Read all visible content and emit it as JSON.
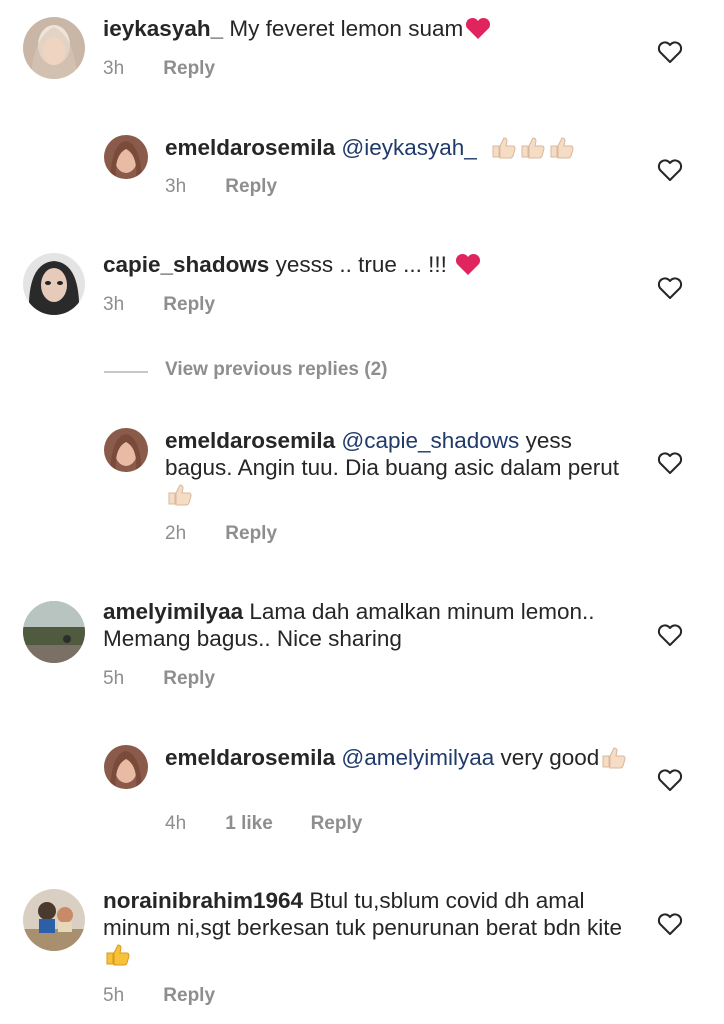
{
  "comments": [
    {
      "id": "c1",
      "username": "ieykasyah_",
      "text": "My feveret lemon suam",
      "emoji_after": "heart",
      "time": "3h",
      "reply": "Reply"
    },
    {
      "id": "r1",
      "username": "emeldarosemila",
      "mention": "@ieykasyah_",
      "text": "",
      "emoji_after": "thumbs3",
      "time": "3h",
      "reply": "Reply"
    },
    {
      "id": "c2",
      "username": "capie_shadows",
      "text": "yesss .. true ... !!!",
      "emoji_after": "heart",
      "time": "3h",
      "reply": "Reply"
    },
    {
      "id": "r2",
      "username": "emeldarosemila",
      "mention": "@capie_shadows",
      "text": "yess bagus. Angin tuu. Dia buang asic dalam perut",
      "emoji_after": "thumb",
      "time": "2h",
      "reply": "Reply"
    },
    {
      "id": "c3",
      "username": "amelyimilyaa",
      "text": "Lama dah amalkan minum lemon.. Memang bagus.. Nice sharing",
      "time": "5h",
      "reply": "Reply"
    },
    {
      "id": "r3",
      "username": "emeldarosemila",
      "mention": "@amelyimilyaa",
      "text": "very good",
      "emoji_after": "thumb",
      "time": "4h",
      "likes": "1 like",
      "reply": "Reply"
    },
    {
      "id": "c4",
      "username": "norainibrahim1964",
      "text": "Btul tu,sblum covid dh amal minum ni,sgt berkesan tuk penurunan berat bdn kite",
      "emoji_after": "thumb-yellow",
      "time": "5h",
      "reply": "Reply"
    }
  ],
  "view_previous": "View previous replies (2)",
  "icons": {
    "like": "heart-outline-icon"
  },
  "colors": {
    "text": "#262626",
    "meta": "#8e8e8e",
    "mention": "#1f3a6b",
    "heart_red": "#e0245e"
  }
}
